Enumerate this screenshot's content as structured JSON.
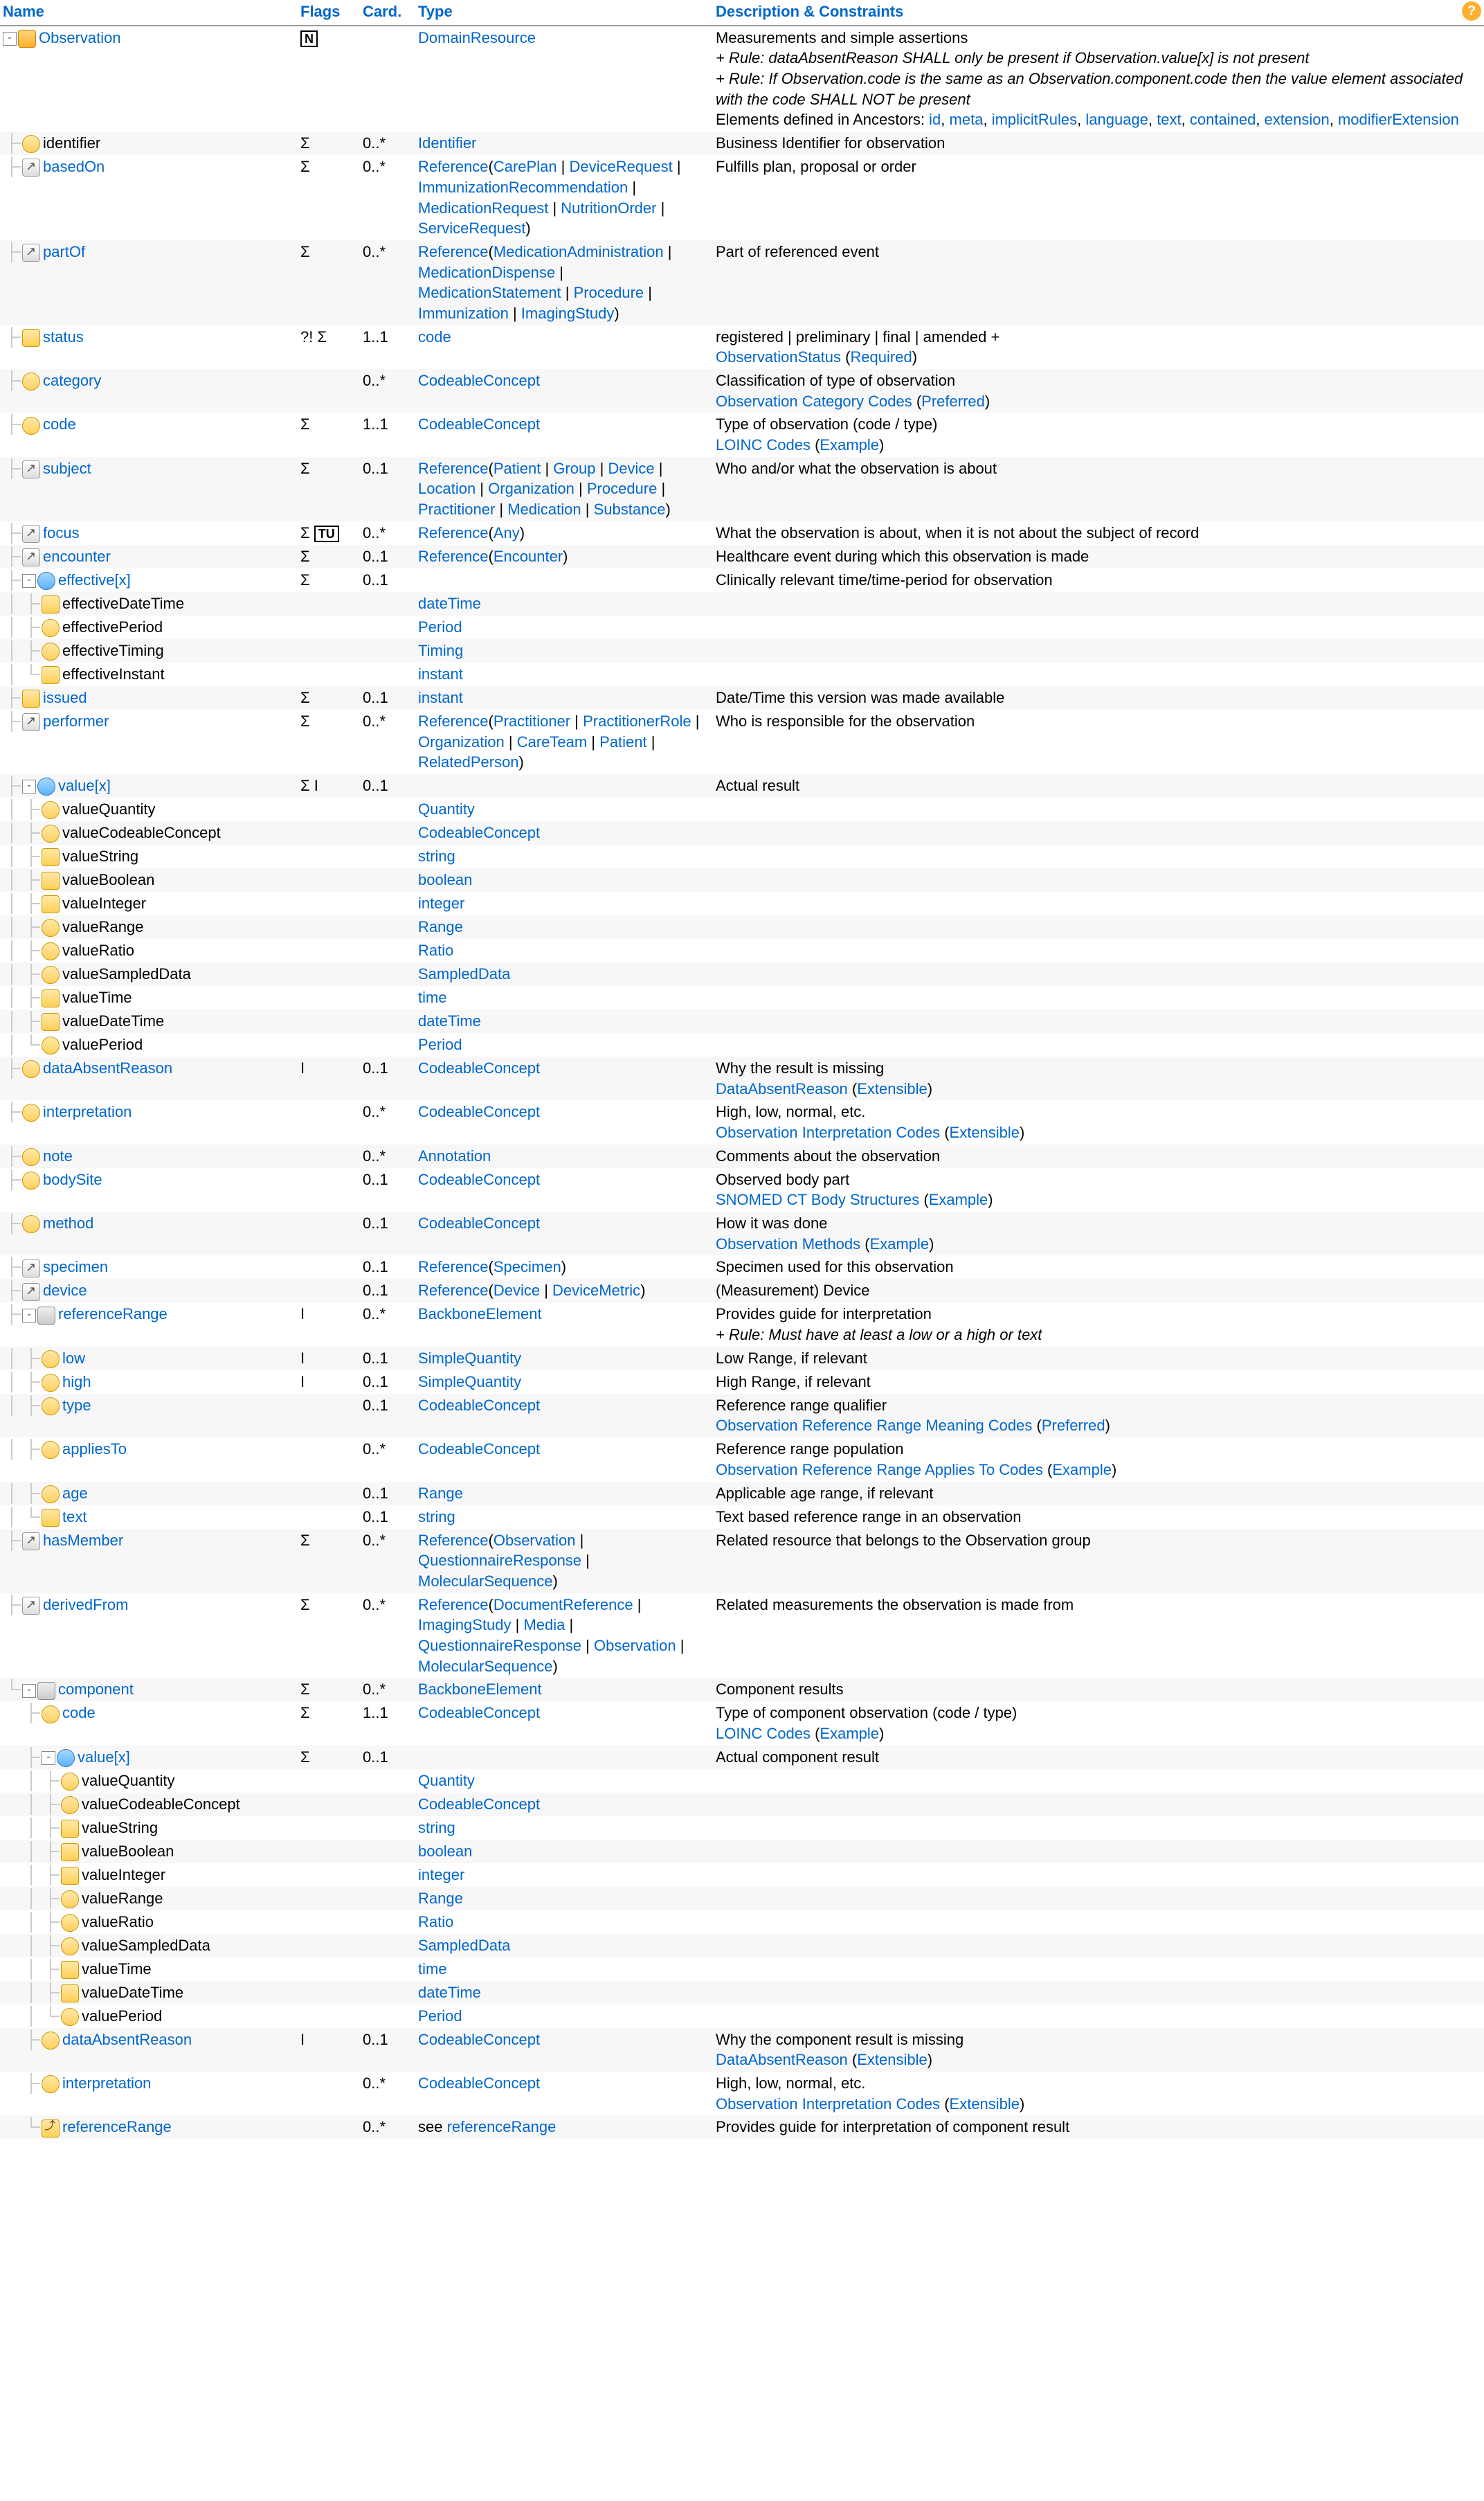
{
  "headers": {
    "name": "Name",
    "flags": "Flags",
    "card": "Card.",
    "type": "Type",
    "desc": "Description & Constraints"
  },
  "help": "?",
  "rows": [
    {
      "depth": 0,
      "last": false,
      "toggle": "-",
      "icon": "res",
      "name": "Observation",
      "nameLink": true,
      "extLink": false,
      "flags": "",
      "flagBox": "N",
      "card": "",
      "typePlain": "",
      "typeLinks": [
        "DomainResource"
      ],
      "desc": "Measurements and simple assertions",
      "rules": [
        "+ Rule: dataAbsentReason SHALL only be present if Observation.value[x] is not present",
        "+ Rule: If Observation.code is the same as an Observation.component.code then the value element associated with the code SHALL NOT be present"
      ],
      "ancestorsLabel": "Elements defined in Ancestors: ",
      "ancestors": [
        "id",
        "meta",
        "implicitRules",
        "language",
        "text",
        "contained",
        "extension",
        "modifierExtension"
      ],
      "alt": false
    },
    {
      "depth": 1,
      "last": false,
      "icon": "dt",
      "name": "identifier",
      "flags": "Σ",
      "card": "0..*",
      "typeLinks": [
        "Identifier"
      ],
      "desc": "Business Identifier for observation",
      "alt": true
    },
    {
      "depth": 1,
      "last": false,
      "icon": "ref",
      "extLink": true,
      "name": "basedOn",
      "nameLink": true,
      "flags": "Σ",
      "card": "0..*",
      "typeRef": "Reference",
      "typeRefArgs": [
        "CarePlan",
        "DeviceRequest",
        "ImmunizationRecommendation",
        "MedicationRequest",
        "NutritionOrder",
        "ServiceRequest"
      ],
      "desc": "Fulfills plan, proposal or order",
      "alt": false
    },
    {
      "depth": 1,
      "last": false,
      "icon": "ref",
      "extLink": true,
      "name": "partOf",
      "nameLink": true,
      "flags": "Σ",
      "card": "0..*",
      "typeRef": "Reference",
      "typeRefArgs": [
        "MedicationAdministration",
        "MedicationDispense",
        "MedicationStatement",
        "Procedure",
        "Immunization",
        "ImagingStudy"
      ],
      "desc": "Part of referenced event",
      "alt": true
    },
    {
      "depth": 1,
      "last": false,
      "icon": "prim",
      "name": "status",
      "nameLink": true,
      "flags": "?! Σ",
      "card": "1..1",
      "typeLinks": [
        "code"
      ],
      "desc": "registered | preliminary | final | amended +",
      "binding": {
        "name": "ObservationStatus",
        "strength": "Required"
      },
      "alt": false
    },
    {
      "depth": 1,
      "last": false,
      "icon": "dt",
      "name": "category",
      "nameLink": true,
      "flags": "",
      "card": "0..*",
      "typeLinks": [
        "CodeableConcept"
      ],
      "desc": "Classification of type of observation",
      "binding": {
        "name": "Observation Category Codes",
        "strength": "Preferred"
      },
      "alt": true
    },
    {
      "depth": 1,
      "last": false,
      "icon": "dt",
      "name": "code",
      "nameLink": true,
      "flags": "Σ",
      "card": "1..1",
      "typeLinks": [
        "CodeableConcept"
      ],
      "desc": "Type of observation (code / type)",
      "binding": {
        "name": "LOINC Codes",
        "strength": "Example"
      },
      "alt": false
    },
    {
      "depth": 1,
      "last": false,
      "icon": "ref",
      "extLink": true,
      "name": "subject",
      "nameLink": true,
      "flags": "Σ",
      "card": "0..1",
      "typeRef": "Reference",
      "typeRefArgs": [
        "Patient",
        "Group",
        "Device",
        "Location",
        "Organization",
        "Procedure",
        "Practitioner",
        "Medication",
        "Substance"
      ],
      "desc": "Who and/or what the observation is about",
      "alt": true
    },
    {
      "depth": 1,
      "last": false,
      "icon": "ref",
      "extLink": true,
      "name": "focus",
      "nameLink": true,
      "flags": "Σ",
      "flagBox": "TU",
      "card": "0..*",
      "typeRef": "Reference",
      "typeRefArgs": [
        "Any"
      ],
      "desc": "What the observation is about, when it is not about the subject of record",
      "alt": false
    },
    {
      "depth": 1,
      "last": false,
      "icon": "ref",
      "extLink": true,
      "name": "encounter",
      "nameLink": true,
      "flags": "Σ",
      "card": "0..1",
      "typeRef": "Reference",
      "typeRefArgs": [
        "Encounter"
      ],
      "desc": "Healthcare event during which this observation is made",
      "alt": true
    },
    {
      "depth": 1,
      "last": false,
      "toggle": "-",
      "icon": "choice",
      "name": "effective[x]",
      "nameLink": true,
      "flags": "Σ",
      "card": "0..1",
      "desc": "Clinically relevant time/time-period for observation",
      "alt": false
    },
    {
      "depth": 2,
      "last": false,
      "icon": "prim",
      "name": "effectiveDateTime",
      "typeLinks": [
        "dateTime"
      ],
      "alt": true
    },
    {
      "depth": 2,
      "last": false,
      "icon": "dt",
      "name": "effectivePeriod",
      "typeLinks": [
        "Period"
      ],
      "alt": false
    },
    {
      "depth": 2,
      "last": false,
      "icon": "dt",
      "name": "effectiveTiming",
      "typeLinks": [
        "Timing"
      ],
      "alt": true
    },
    {
      "depth": 2,
      "last": true,
      "icon": "prim",
      "name": "effectiveInstant",
      "typeLinks": [
        "instant"
      ],
      "alt": false
    },
    {
      "depth": 1,
      "last": false,
      "icon": "prim",
      "name": "issued",
      "nameLink": true,
      "flags": "Σ",
      "card": "0..1",
      "typeLinks": [
        "instant"
      ],
      "desc": "Date/Time this version was made available",
      "alt": true
    },
    {
      "depth": 1,
      "last": false,
      "icon": "ref",
      "extLink": true,
      "name": "performer",
      "nameLink": true,
      "flags": "Σ",
      "card": "0..*",
      "typeRef": "Reference",
      "typeRefArgs": [
        "Practitioner",
        "PractitionerRole",
        "Organization",
        "CareTeam",
        "Patient",
        "RelatedPerson"
      ],
      "desc": "Who is responsible for the observation",
      "alt": false
    },
    {
      "depth": 1,
      "last": false,
      "toggle": "-",
      "icon": "choice",
      "name": "value[x]",
      "nameLink": true,
      "flags": "Σ I",
      "card": "0..1",
      "desc": "Actual result",
      "alt": true
    },
    {
      "depth": 2,
      "last": false,
      "icon": "dt",
      "name": "valueQuantity",
      "typeLinks": [
        "Quantity"
      ],
      "alt": false
    },
    {
      "depth": 2,
      "last": false,
      "icon": "dt",
      "name": "valueCodeableConcept",
      "typeLinks": [
        "CodeableConcept"
      ],
      "alt": true
    },
    {
      "depth": 2,
      "last": false,
      "icon": "prim",
      "name": "valueString",
      "typeLinks": [
        "string"
      ],
      "alt": false
    },
    {
      "depth": 2,
      "last": false,
      "icon": "prim",
      "name": "valueBoolean",
      "typeLinks": [
        "boolean"
      ],
      "alt": true
    },
    {
      "depth": 2,
      "last": false,
      "icon": "prim",
      "name": "valueInteger",
      "typeLinks": [
        "integer"
      ],
      "alt": false
    },
    {
      "depth": 2,
      "last": false,
      "icon": "dt",
      "name": "valueRange",
      "typeLinks": [
        "Range"
      ],
      "alt": true
    },
    {
      "depth": 2,
      "last": false,
      "icon": "dt",
      "name": "valueRatio",
      "typeLinks": [
        "Ratio"
      ],
      "alt": false
    },
    {
      "depth": 2,
      "last": false,
      "icon": "dt",
      "name": "valueSampledData",
      "typeLinks": [
        "SampledData"
      ],
      "alt": true
    },
    {
      "depth": 2,
      "last": false,
      "icon": "prim",
      "name": "valueTime",
      "typeLinks": [
        "time"
      ],
      "alt": false
    },
    {
      "depth": 2,
      "last": false,
      "icon": "prim",
      "name": "valueDateTime",
      "typeLinks": [
        "dateTime"
      ],
      "alt": true
    },
    {
      "depth": 2,
      "last": true,
      "icon": "dt",
      "name": "valuePeriod",
      "typeLinks": [
        "Period"
      ],
      "alt": false
    },
    {
      "depth": 1,
      "last": false,
      "icon": "dt",
      "name": "dataAbsentReason",
      "nameLink": true,
      "flags": "I",
      "card": "0..1",
      "typeLinks": [
        "CodeableConcept"
      ],
      "desc": "Why the result is missing",
      "binding": {
        "name": "DataAbsentReason",
        "strength": "Extensible"
      },
      "alt": true
    },
    {
      "depth": 1,
      "last": false,
      "icon": "dt",
      "name": "interpretation",
      "nameLink": true,
      "flags": "",
      "card": "0..*",
      "typeLinks": [
        "CodeableConcept"
      ],
      "desc": "High, low, normal, etc.",
      "binding": {
        "name": "Observation Interpretation Codes",
        "strength": "Extensible"
      },
      "alt": false
    },
    {
      "depth": 1,
      "last": false,
      "icon": "dt",
      "name": "note",
      "nameLink": true,
      "flags": "",
      "card": "0..*",
      "typeLinks": [
        "Annotation"
      ],
      "desc": "Comments about the observation",
      "alt": true
    },
    {
      "depth": 1,
      "last": false,
      "icon": "dt",
      "name": "bodySite",
      "nameLink": true,
      "flags": "",
      "card": "0..1",
      "typeLinks": [
        "CodeableConcept"
      ],
      "desc": "Observed body part",
      "binding": {
        "name": "SNOMED CT Body Structures",
        "strength": "Example"
      },
      "alt": false
    },
    {
      "depth": 1,
      "last": false,
      "icon": "dt",
      "name": "method",
      "nameLink": true,
      "flags": "",
      "card": "0..1",
      "typeLinks": [
        "CodeableConcept"
      ],
      "desc": "How it was done",
      "binding": {
        "name": "Observation Methods",
        "strength": "Example"
      },
      "alt": true
    },
    {
      "depth": 1,
      "last": false,
      "icon": "ref",
      "extLink": true,
      "name": "specimen",
      "nameLink": true,
      "flags": "",
      "card": "0..1",
      "typeRef": "Reference",
      "typeRefArgs": [
        "Specimen"
      ],
      "desc": "Specimen used for this observation",
      "alt": false
    },
    {
      "depth": 1,
      "last": false,
      "icon": "ref",
      "extLink": true,
      "name": "device",
      "nameLink": true,
      "flags": "",
      "card": "0..1",
      "typeRef": "Reference",
      "typeRefArgs": [
        "Device",
        "DeviceMetric"
      ],
      "desc": "(Measurement) Device",
      "alt": true
    },
    {
      "depth": 1,
      "last": false,
      "toggle": "-",
      "icon": "el",
      "name": "referenceRange",
      "nameLink": true,
      "flags": "I",
      "card": "0..*",
      "typeLinks": [
        "BackboneElement"
      ],
      "desc": "Provides guide for interpretation",
      "rules": [
        "+ Rule: Must have at least a low or a high or text"
      ],
      "alt": false
    },
    {
      "depth": 2,
      "last": false,
      "icon": "dt",
      "name": "low",
      "nameLink": true,
      "flags": "I",
      "card": "0..1",
      "typeLinks": [
        "SimpleQuantity"
      ],
      "desc": "Low Range, if relevant",
      "alt": true
    },
    {
      "depth": 2,
      "last": false,
      "icon": "dt",
      "name": "high",
      "nameLink": true,
      "flags": "I",
      "card": "0..1",
      "typeLinks": [
        "SimpleQuantity"
      ],
      "desc": "High Range, if relevant",
      "alt": false
    },
    {
      "depth": 2,
      "last": false,
      "icon": "dt",
      "name": "type",
      "nameLink": true,
      "flags": "",
      "card": "0..1",
      "typeLinks": [
        "CodeableConcept"
      ],
      "desc": "Reference range qualifier",
      "binding": {
        "name": "Observation Reference Range Meaning Codes",
        "strength": "Preferred"
      },
      "alt": true
    },
    {
      "depth": 2,
      "last": false,
      "icon": "dt",
      "name": "appliesTo",
      "nameLink": true,
      "flags": "",
      "card": "0..*",
      "typeLinks": [
        "CodeableConcept"
      ],
      "desc": "Reference range population",
      "binding": {
        "name": "Observation Reference Range Applies To Codes",
        "strength": "Example"
      },
      "alt": false
    },
    {
      "depth": 2,
      "last": false,
      "icon": "dt",
      "name": "age",
      "nameLink": true,
      "flags": "",
      "card": "0..1",
      "typeLinks": [
        "Range"
      ],
      "desc": "Applicable age range, if relevant",
      "alt": true
    },
    {
      "depth": 2,
      "last": true,
      "icon": "prim",
      "name": "text",
      "nameLink": true,
      "flags": "",
      "card": "0..1",
      "typeLinks": [
        "string"
      ],
      "desc": "Text based reference range in an observation",
      "alt": false
    },
    {
      "depth": 1,
      "last": false,
      "icon": "ref",
      "extLink": true,
      "name": "hasMember",
      "nameLink": true,
      "flags": "Σ",
      "card": "0..*",
      "typeRef": "Reference",
      "typeRefArgs": [
        "Observation",
        "QuestionnaireResponse",
        "MolecularSequence"
      ],
      "desc": "Related resource that belongs to the Observation group",
      "alt": true
    },
    {
      "depth": 1,
      "last": false,
      "icon": "ref",
      "extLink": true,
      "name": "derivedFrom",
      "nameLink": true,
      "flags": "Σ",
      "card": "0..*",
      "typeRef": "Reference",
      "typeRefArgs": [
        "DocumentReference",
        "ImagingStudy",
        "Media",
        "QuestionnaireResponse",
        "Observation",
        "MolecularSequence"
      ],
      "desc": "Related measurements the observation is made from",
      "alt": false
    },
    {
      "depth": 1,
      "last": true,
      "toggle": "-",
      "icon": "el",
      "name": "component",
      "nameLink": true,
      "flags": "Σ",
      "card": "0..*",
      "typeLinks": [
        "BackboneElement"
      ],
      "desc": "Component results",
      "alt": true,
      "parentsLast": [
        true
      ]
    },
    {
      "depth": 2,
      "last": false,
      "icon": "dt",
      "name": "code",
      "nameLink": true,
      "flags": "Σ",
      "card": "1..1",
      "typeLinks": [
        "CodeableConcept"
      ],
      "desc": "Type of component observation (code / type)",
      "binding": {
        "name": "LOINC Codes",
        "strength": "Example"
      },
      "alt": false,
      "parentsLast": [
        true,
        false
      ]
    },
    {
      "depth": 2,
      "last": false,
      "toggle": "-",
      "icon": "choice",
      "name": "value[x]",
      "nameLink": true,
      "flags": "Σ",
      "card": "0..1",
      "desc": "Actual component result",
      "alt": true,
      "parentsLast": [
        true,
        false
      ]
    },
    {
      "depth": 3,
      "last": false,
      "icon": "dt",
      "name": "valueQuantity",
      "typeLinks": [
        "Quantity"
      ],
      "alt": false,
      "parentsLast": [
        true,
        false,
        false
      ]
    },
    {
      "depth": 3,
      "last": false,
      "icon": "dt",
      "name": "valueCodeableConcept",
      "typeLinks": [
        "CodeableConcept"
      ],
      "alt": true,
      "parentsLast": [
        true,
        false,
        false
      ]
    },
    {
      "depth": 3,
      "last": false,
      "icon": "prim",
      "name": "valueString",
      "typeLinks": [
        "string"
      ],
      "alt": false,
      "parentsLast": [
        true,
        false,
        false
      ]
    },
    {
      "depth": 3,
      "last": false,
      "icon": "prim",
      "name": "valueBoolean",
      "typeLinks": [
        "boolean"
      ],
      "alt": true,
      "parentsLast": [
        true,
        false,
        false
      ]
    },
    {
      "depth": 3,
      "last": false,
      "icon": "prim",
      "name": "valueInteger",
      "typeLinks": [
        "integer"
      ],
      "alt": false,
      "parentsLast": [
        true,
        false,
        false
      ]
    },
    {
      "depth": 3,
      "last": false,
      "icon": "dt",
      "name": "valueRange",
      "typeLinks": [
        "Range"
      ],
      "alt": true,
      "parentsLast": [
        true,
        false,
        false
      ]
    },
    {
      "depth": 3,
      "last": false,
      "icon": "dt",
      "name": "valueRatio",
      "typeLinks": [
        "Ratio"
      ],
      "alt": false,
      "parentsLast": [
        true,
        false,
        false
      ]
    },
    {
      "depth": 3,
      "last": false,
      "icon": "dt",
      "name": "valueSampledData",
      "typeLinks": [
        "SampledData"
      ],
      "alt": true,
      "parentsLast": [
        true,
        false,
        false
      ]
    },
    {
      "depth": 3,
      "last": false,
      "icon": "prim",
      "name": "valueTime",
      "typeLinks": [
        "time"
      ],
      "alt": false,
      "parentsLast": [
        true,
        false,
        false
      ]
    },
    {
      "depth": 3,
      "last": false,
      "icon": "prim",
      "name": "valueDateTime",
      "typeLinks": [
        "dateTime"
      ],
      "alt": true,
      "parentsLast": [
        true,
        false,
        false
      ]
    },
    {
      "depth": 3,
      "last": true,
      "icon": "dt",
      "name": "valuePeriod",
      "typeLinks": [
        "Period"
      ],
      "alt": false,
      "parentsLast": [
        true,
        false,
        false
      ]
    },
    {
      "depth": 2,
      "last": false,
      "icon": "dt",
      "name": "dataAbsentReason",
      "nameLink": true,
      "flags": "I",
      "card": "0..1",
      "typeLinks": [
        "CodeableConcept"
      ],
      "desc": "Why the component result is missing",
      "binding": {
        "name": "DataAbsentReason",
        "strength": "Extensible"
      },
      "alt": true,
      "parentsLast": [
        true,
        false
      ]
    },
    {
      "depth": 2,
      "last": false,
      "icon": "dt",
      "name": "interpretation",
      "nameLink": true,
      "flags": "",
      "card": "0..*",
      "typeLinks": [
        "CodeableConcept"
      ],
      "desc": "High, low, normal, etc.",
      "binding": {
        "name": "Observation Interpretation Codes",
        "strength": "Extensible"
      },
      "alt": false,
      "parentsLast": [
        true,
        false
      ]
    },
    {
      "depth": 2,
      "last": true,
      "icon": "reuse",
      "name": "referenceRange",
      "nameLink": true,
      "flags": "",
      "card": "0..*",
      "typePlain": "see ",
      "typeLinks": [
        "referenceRange"
      ],
      "desc": "Provides guide for interpretation of component result",
      "alt": true,
      "parentsLast": [
        true,
        true
      ]
    }
  ]
}
